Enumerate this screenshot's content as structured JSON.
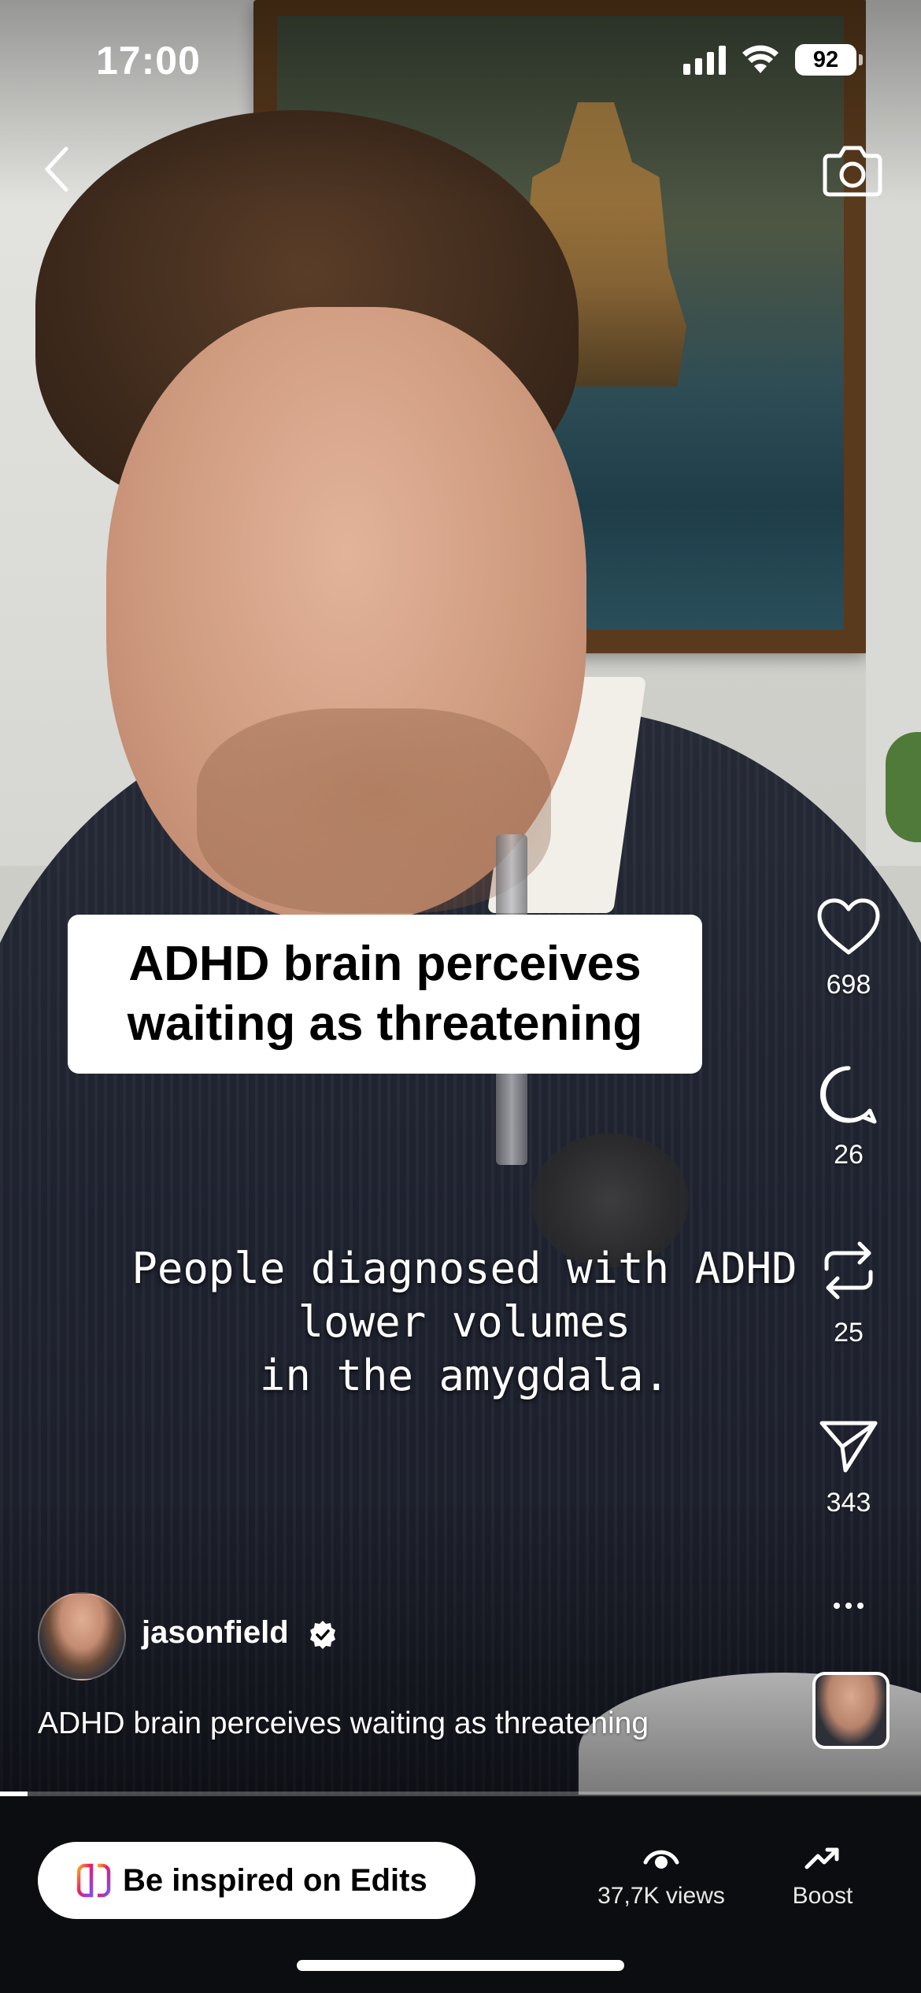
{
  "status_bar": {
    "time": "17:00",
    "battery": "92",
    "icons": [
      "signal-icon",
      "wifi-icon",
      "battery-icon"
    ]
  },
  "top_bar": {
    "back_icon": "chevron-left-icon",
    "camera_icon": "camera-icon"
  },
  "video": {
    "headline": "ADHD brain perceives\nwaiting as threatening",
    "subtitle": "People diagnosed with ADHD\nlower volumes\nin the amygdala.",
    "progress": 0.03
  },
  "actions": {
    "likes": "698",
    "comments": "26",
    "reposts": "25",
    "shares": "343",
    "icons": [
      "heart-icon",
      "comment-icon",
      "repost-icon",
      "send-icon",
      "more-icon"
    ]
  },
  "author": {
    "username": "jasonfield",
    "verified": true
  },
  "caption": "ADHD brain perceives waiting as threatening",
  "bottom_bar": {
    "edits_button": "Be inspired on Edits",
    "views_label": "37,7K views",
    "boost_label": "Boost"
  },
  "colors": {
    "background": "#0b0d10",
    "text": "#ffffff",
    "headline_box": "#ffffff"
  }
}
